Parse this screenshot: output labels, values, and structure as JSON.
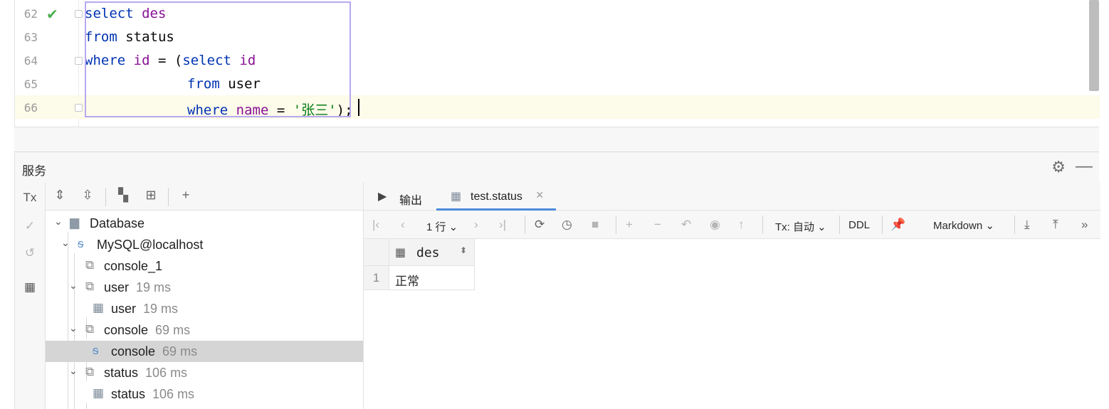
{
  "editor": {
    "lines": [
      {
        "num": "62",
        "t1": "select",
        "t2": " ",
        "t3": "des",
        "t4": "",
        "t5": "",
        "t6": ""
      },
      {
        "num": "63",
        "t1": "from",
        "t2": " status",
        "t3": "",
        "t4": "",
        "t5": "",
        "t6": ""
      },
      {
        "num": "64",
        "t1": "where",
        "t2": " ",
        "t3": "id",
        "t4": " = (",
        "t5": "select",
        "t6": " id"
      },
      {
        "num": "65",
        "t1": "from",
        "t2": " user",
        "t3": "",
        "t4": "",
        "t5": "",
        "t6": ""
      },
      {
        "num": "66",
        "t1": "where",
        "t2": " ",
        "t3": "name",
        "t4": " = ",
        "t5": "'张三'",
        "t6": ");"
      }
    ]
  },
  "services": {
    "title": "服务",
    "side_strip": {
      "tx": "Tx"
    },
    "tree": [
      {
        "label": "Database",
        "time": ""
      },
      {
        "label": "MySQL@localhost",
        "time": ""
      },
      {
        "label": "console_1",
        "time": ""
      },
      {
        "label": "user",
        "time": "19 ms"
      },
      {
        "label": "user",
        "time": "19 ms"
      },
      {
        "label": "console",
        "time": "69 ms"
      },
      {
        "label": "console",
        "time": "69 ms"
      },
      {
        "label": "status",
        "time": "106 ms"
      },
      {
        "label": "status",
        "time": "106 ms"
      }
    ]
  },
  "results": {
    "tabs": [
      {
        "label": "输出"
      },
      {
        "label": "test.status"
      }
    ],
    "toolbar": {
      "rows": "1 行",
      "tx": "Tx: 自动",
      "ddl": "DDL",
      "format": "Markdown"
    },
    "grid": {
      "columns": [
        "des"
      ],
      "rows": [
        {
          "num": "1",
          "des": "正常"
        }
      ]
    }
  },
  "colors": {
    "keyword": "#0033b3",
    "identifier": "#871094",
    "string": "#067d17",
    "selection_border": "#b7a8f0",
    "current_line": "#fdfbe9",
    "active_tab": "#4a8bd9"
  }
}
